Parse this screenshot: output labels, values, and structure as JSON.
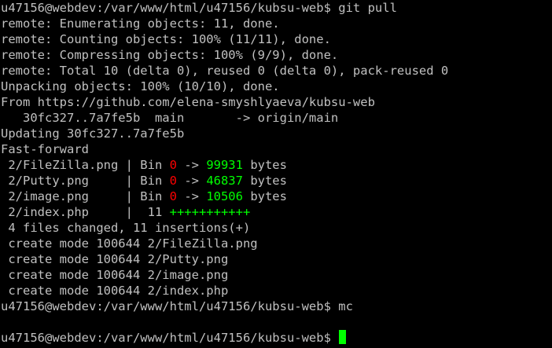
{
  "colors": {
    "background": "#000000",
    "text": "#c0c0c0",
    "deleted": "#ff0000",
    "added": "#00ff00",
    "cursor": "#00ff00"
  },
  "terminal": {
    "prompt": "u47156@webdev:/var/www/html/u47156/kubsu-web$",
    "commands": {
      "pull": " git pull",
      "mc": " mc"
    },
    "remote_lines": [
      "remote: Enumerating objects: 11, done.",
      "remote: Counting objects: 100% (11/11), done.",
      "remote: Compressing objects: 100% (9/9), done.",
      "remote: Total 10 (delta 0), reused 0 (delta 0), pack-reused 0",
      "Unpacking objects: 100% (10/10), done.",
      "From https://github.com/elena-smyshlyaeva/kubsu-web",
      "   30fc327..7a7fe5b  main       -> origin/main",
      "Updating 30fc327..7a7fe5b",
      "Fast-forward"
    ],
    "file_changes": [
      {
        "file": " 2/FileZilla.png | Bin ",
        "from": "0",
        "arrow": " -> ",
        "to": "99931",
        "unit": " bytes"
      },
      {
        "file": " 2/Putty.png     | Bin ",
        "from": "0",
        "arrow": " -> ",
        "to": "46837",
        "unit": " bytes"
      },
      {
        "file": " 2/image.png     | Bin ",
        "from": "0",
        "arrow": " -> ",
        "to": "10506",
        "unit": " bytes"
      }
    ],
    "index_change": {
      "file": " 2/index.php     |  11 ",
      "plus": "+++++++++++"
    },
    "summary": " 4 files changed, 11 insertions(+)",
    "create_lines": [
      " create mode 100644 2/FileZilla.png",
      " create mode 100644 2/Putty.png",
      " create mode 100644 2/image.png",
      " create mode 100644 2/index.php"
    ]
  }
}
